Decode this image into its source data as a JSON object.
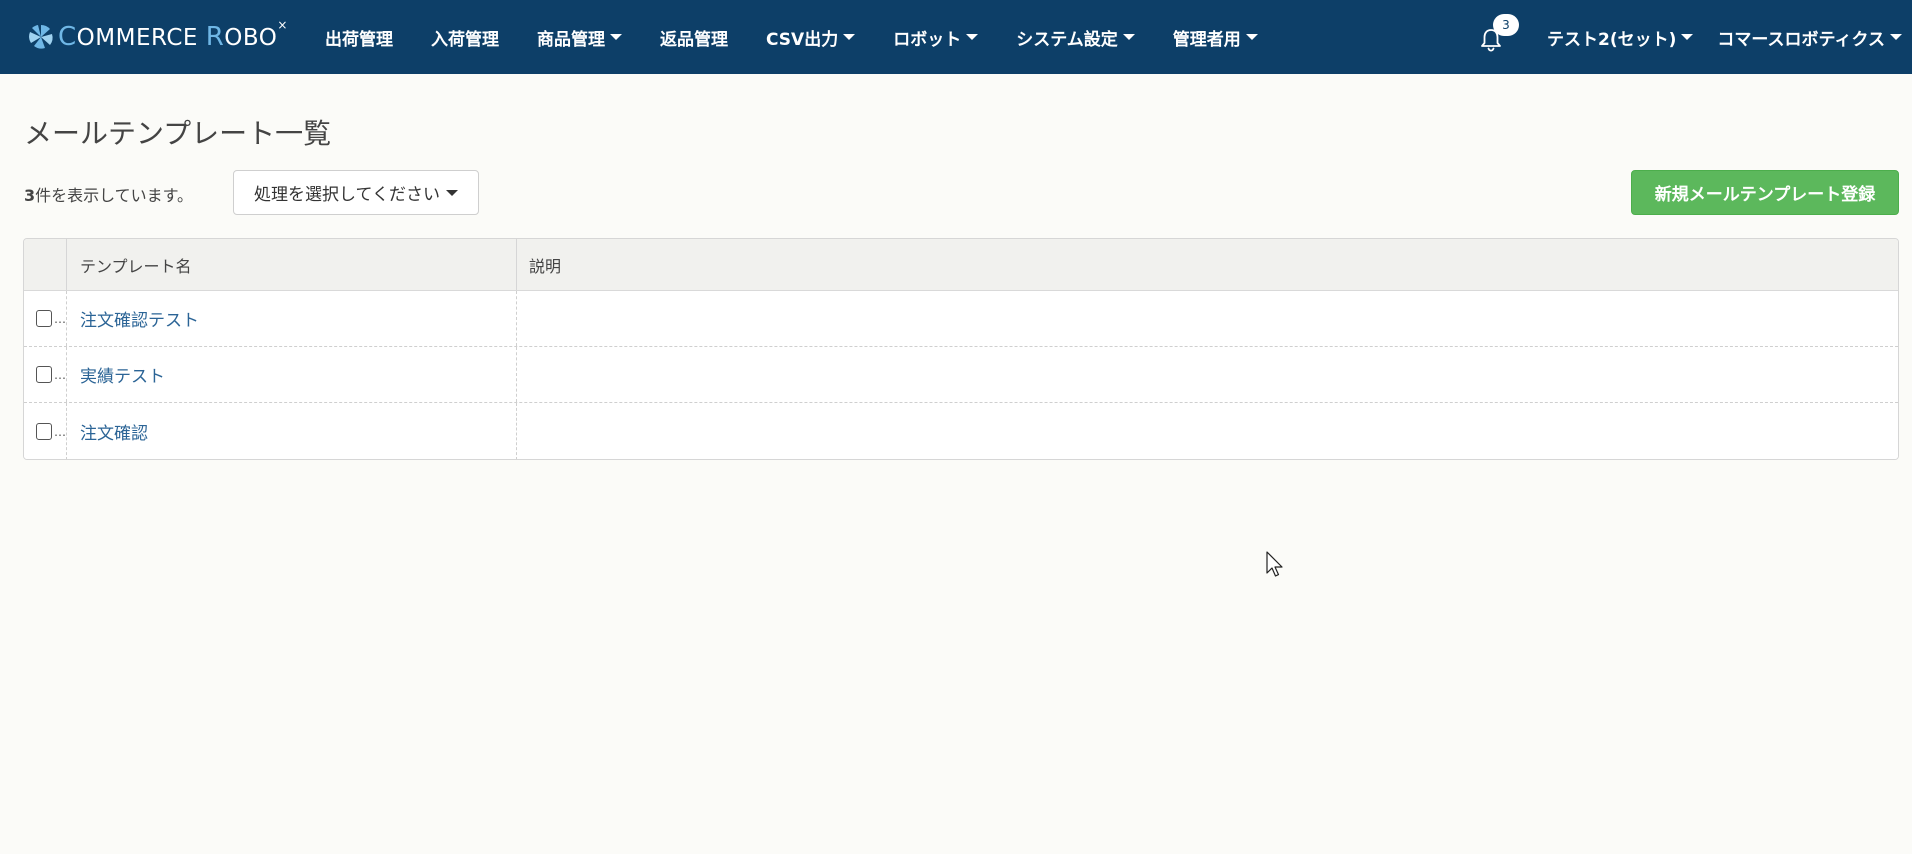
{
  "navbar": {
    "brand": {
      "first": "C",
      "mid": "OMMERCE ",
      "second": "R",
      "end": "OBO",
      "mark": "×"
    },
    "items": [
      {
        "label": "出荷管理",
        "dropdown": false
      },
      {
        "label": "入荷管理",
        "dropdown": false
      },
      {
        "label": "商品管理",
        "dropdown": true
      },
      {
        "label": "返品管理",
        "dropdown": false
      },
      {
        "label": "CSV出力",
        "dropdown": true
      },
      {
        "label": "ロボット",
        "dropdown": true
      },
      {
        "label": "システム設定",
        "dropdown": true
      },
      {
        "label": "管理者用",
        "dropdown": true
      }
    ],
    "notification_count": "3",
    "user_label": "テスト2(セット)",
    "company_label": "コマースロボティクス",
    "colors": {
      "background": "#0d3f68",
      "text": "#ffffff"
    }
  },
  "main": {
    "title": "メールテンプレート一覧",
    "count_number": "3",
    "count_suffix": "件を表示しています。",
    "action_select_label": "処理を選択してください",
    "new_button_label": "新規メールテンプレート登録",
    "new_button_color": "#5cb85c"
  },
  "table": {
    "columns": {
      "name": "テンプレート名",
      "description": "説明"
    },
    "rows": [
      {
        "name": "注文確認テスト",
        "description": ""
      },
      {
        "name": "実績テスト",
        "description": ""
      },
      {
        "name": "注文確認",
        "description": ""
      }
    ],
    "row_menu_glyph": "…",
    "link_color": "#2b6496"
  }
}
